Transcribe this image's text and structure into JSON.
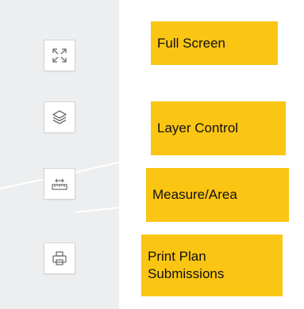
{
  "map": {
    "background": "#eceef0"
  },
  "toolbar": {
    "items": [
      {
        "icon": "full-screen-icon",
        "callout": "Full Screen"
      },
      {
        "icon": "layers-icon",
        "callout": "Layer Control"
      },
      {
        "icon": "ruler-measure-icon",
        "callout": "Measure/Area"
      },
      {
        "icon": "printer-icon",
        "callout": "Print Plan Submissions"
      }
    ]
  },
  "colors": {
    "callout_background": "#fbc513",
    "button_background": "#ffffff",
    "button_border": "#d2d4d6",
    "icon_stroke": "#6b6f73"
  }
}
